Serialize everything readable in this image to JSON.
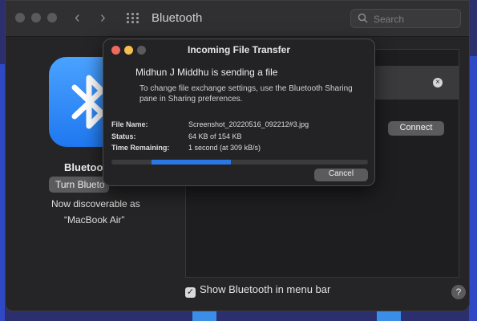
{
  "window": {
    "title": "Bluetooth",
    "search_placeholder": "Search"
  },
  "sidebar": {
    "name_label": "Bluetoot",
    "toggle_button_label": "Turn Blueto",
    "discoverable_line1": "Now discoverable as",
    "discoverable_line2": "“MacBook Air”"
  },
  "devices": {
    "connect_label": "Connect"
  },
  "footer": {
    "show_in_menubar_label": "Show Bluetooth in menu bar",
    "show_in_menubar_checked": true,
    "help_label": "?"
  },
  "dialog": {
    "title": "Incoming File Transfer",
    "heading": "Midhun J Middhu is sending a file",
    "subtext": "To change file exchange settings, use the Bluetooth Sharing pane in Sharing preferences.",
    "fields": [
      {
        "label": "File Name:",
        "value": "Screenshot_20220516_092212#3.jpg"
      },
      {
        "label": "Status:",
        "value": "64 KB of 154 KB"
      },
      {
        "label": "Time Remaining:",
        "value": "1 second (at 309 kB/s)"
      }
    ],
    "progress_fraction": 0.31,
    "cancel_label": "Cancel"
  },
  "colors": {
    "accent": "#2a78e6",
    "close": "#ec6a5e",
    "minimize": "#f4bf4f"
  },
  "icons": [
    "search-icon",
    "back-arrow-icon",
    "forward-arrow-icon",
    "grid-icon",
    "bluetooth-icon",
    "clear-icon",
    "checkbox-icon",
    "help-icon"
  ]
}
